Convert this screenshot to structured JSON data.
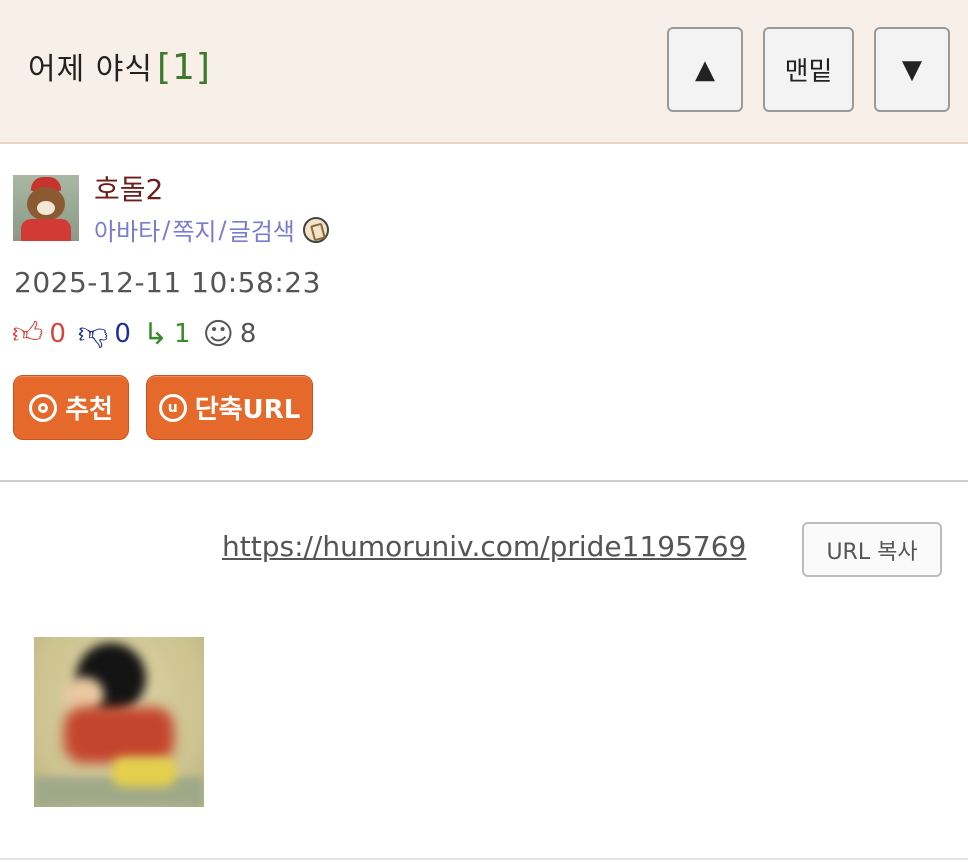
{
  "header": {
    "title": "어제 야식",
    "comment_count": "[1]",
    "btn_up": "▲",
    "btn_bottom": "맨밑",
    "btn_down": "▼"
  },
  "author": {
    "nickname": "호돌2",
    "links": [
      "아바타",
      "쪽지",
      "글검색"
    ],
    "link_separator": "/"
  },
  "post": {
    "date": "2025-12-11 10:58:23",
    "stats": {
      "up": "0",
      "down": "0",
      "replies": "1",
      "views": "8"
    },
    "recommend_label": "추천",
    "short_url_label": "단축URL",
    "url": "https://humoruniv.com/pride1195769",
    "copy_url_label": "URL 복사"
  },
  "colors": {
    "header_bg": "#f8f0e8",
    "accent_button": "#e4692a",
    "nickname": "#6a1e1e",
    "links": "#7b7bd0",
    "comment_count": "#3a7a2a"
  },
  "icons": {
    "thumbs_up": "thumbs-up-icon",
    "thumbs_down": "thumbs-down-icon",
    "reply": "reply-icon",
    "view": "smiley-icon",
    "badge": "badge-icon"
  }
}
